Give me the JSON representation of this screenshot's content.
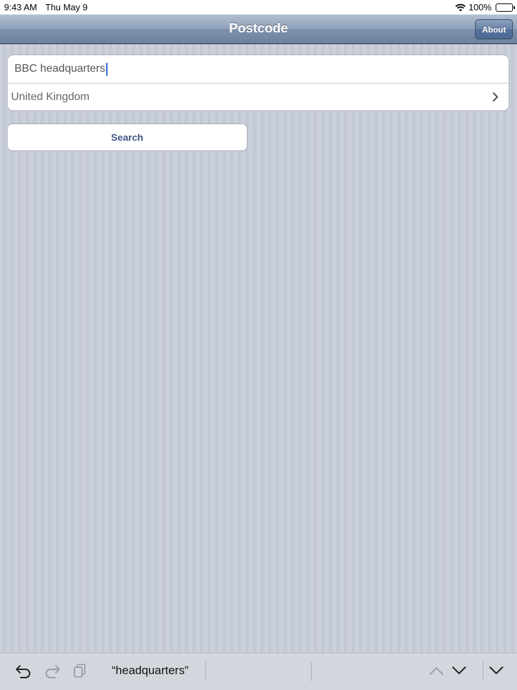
{
  "status_bar": {
    "time": "9:43 AM",
    "date": "Thu May 9",
    "battery": "100%",
    "icons": [
      "wifi-icon",
      "battery-icon"
    ]
  },
  "nav": {
    "title": "Postcode",
    "about_label": "About"
  },
  "form": {
    "search_value": "BBC headquarters",
    "country": "United Kingdom"
  },
  "search_button_label": "Search",
  "keyboard_bar": {
    "suggestion": "“headquarters”",
    "icons": [
      "undo-icon",
      "redo-icon",
      "paste-icon",
      "chevron-up-icon",
      "chevron-down-icon",
      "dismiss-keyboard-icon"
    ]
  },
  "colors": {
    "nav_gradient_top": "#b4c1d3",
    "nav_gradient_bottom": "#6d82a0",
    "background": "#c5cbd6",
    "button_text": "#3d5585",
    "caret": "#2f6bd8"
  }
}
